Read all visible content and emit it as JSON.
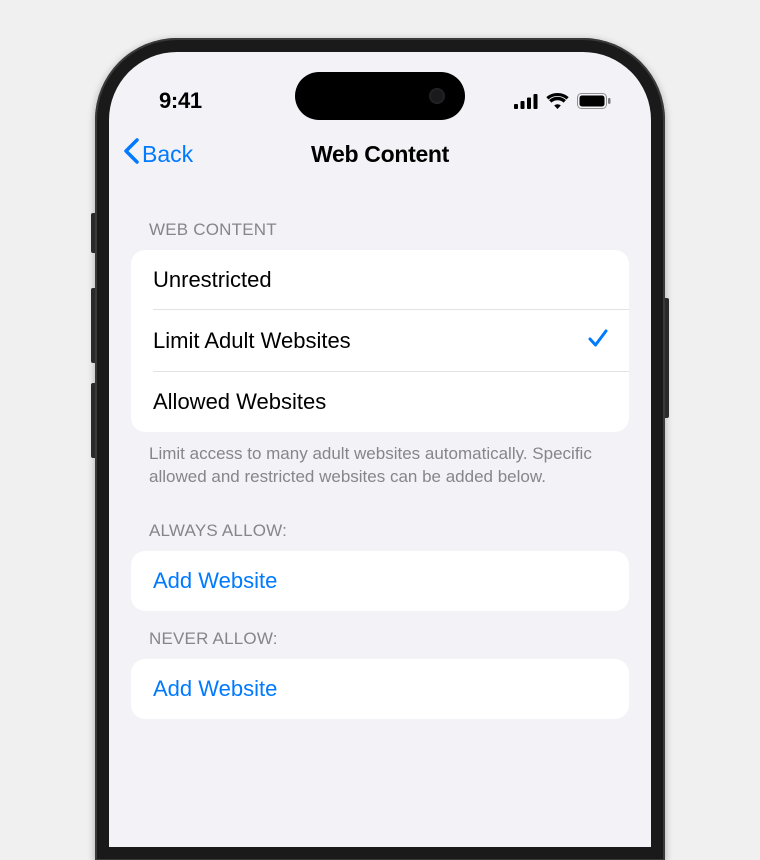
{
  "statusBar": {
    "time": "9:41"
  },
  "nav": {
    "backLabel": "Back",
    "title": "Web Content"
  },
  "sections": {
    "webContent": {
      "header": "WEB CONTENT",
      "options": [
        {
          "label": "Unrestricted",
          "selected": false
        },
        {
          "label": "Limit Adult Websites",
          "selected": true
        },
        {
          "label": "Allowed Websites",
          "selected": false
        }
      ],
      "footer": "Limit access to many adult websites automatically. Specific allowed and restricted websites can be added below."
    },
    "alwaysAllow": {
      "header": "ALWAYS ALLOW:",
      "addLabel": "Add Website"
    },
    "neverAllow": {
      "header": "NEVER ALLOW:",
      "addLabel": "Add Website"
    }
  },
  "colors": {
    "accent": "#007aff",
    "background": "#f2f2f7",
    "cardBackground": "#ffffff",
    "secondaryText": "#86868a"
  }
}
